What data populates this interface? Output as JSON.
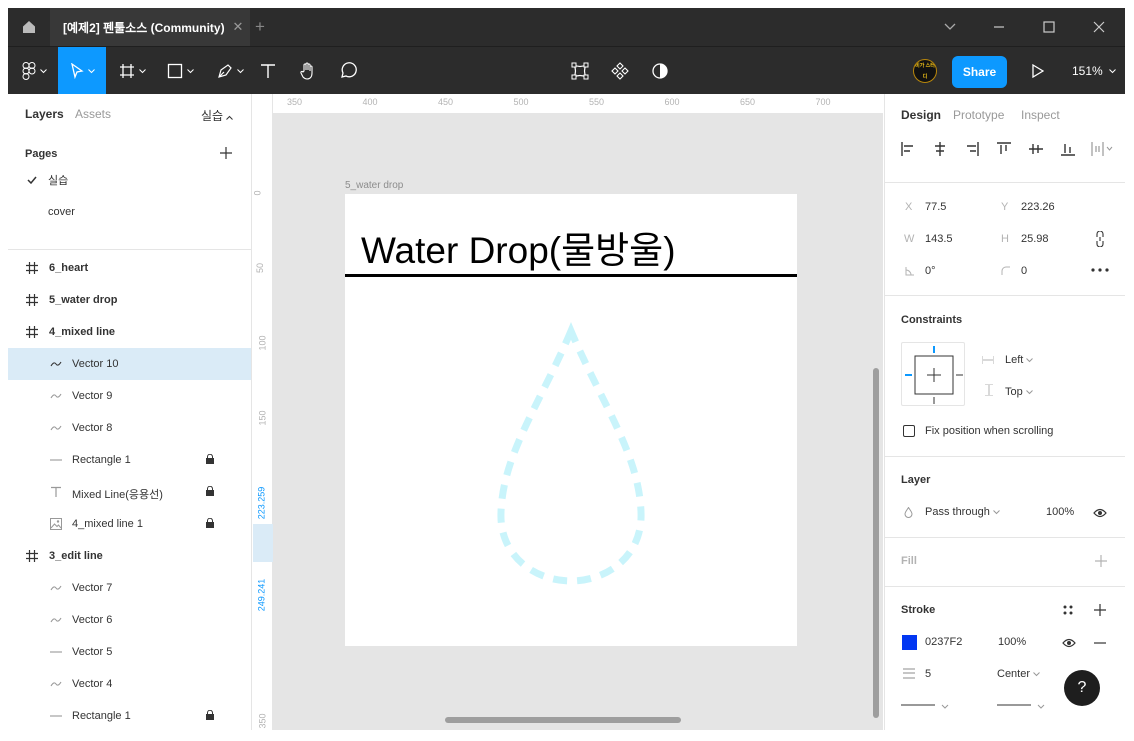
{
  "title_bar": {
    "tab_title": "[예제2] 펜툴소스 (Community)",
    "tab_close": "✕",
    "tab_add": "+"
  },
  "toolbar": {
    "share_label": "Share",
    "zoom": "151%",
    "avatar_text": "비가 스터디",
    "accent_color": "#0d99ff"
  },
  "left_panel": {
    "tabs": [
      "Layers",
      "Assets"
    ],
    "current_page_label": "실습",
    "pages_title": "Pages",
    "pages": [
      "실습",
      "cover"
    ],
    "layers": [
      {
        "label": "6_heart",
        "type": "frame",
        "indent": 0
      },
      {
        "label": "5_water drop",
        "type": "frame",
        "indent": 0
      },
      {
        "label": "4_mixed line",
        "type": "frame",
        "indent": 0
      },
      {
        "label": "Vector 10",
        "type": "vector",
        "indent": 1,
        "selected": true
      },
      {
        "label": "Vector 9",
        "type": "vector",
        "indent": 1
      },
      {
        "label": "Vector 8",
        "type": "vector",
        "indent": 1
      },
      {
        "label": "Rectangle 1",
        "type": "line",
        "indent": 1,
        "locked": true
      },
      {
        "label": "Mixed Line(응용선)",
        "type": "text",
        "indent": 1,
        "locked": true
      },
      {
        "label": "4_mixed line 1",
        "type": "image",
        "indent": 1,
        "locked": true
      },
      {
        "label": "3_edit line",
        "type": "frame",
        "indent": 0
      },
      {
        "label": "Vector 7",
        "type": "vector",
        "indent": 1
      },
      {
        "label": "Vector 6",
        "type": "vector",
        "indent": 1
      },
      {
        "label": "Vector 5",
        "type": "line",
        "indent": 1
      },
      {
        "label": "Vector 4",
        "type": "vector",
        "indent": 1
      },
      {
        "label": "Rectangle 1",
        "type": "line",
        "indent": 1,
        "locked": true
      }
    ]
  },
  "canvas": {
    "ruler_x": [
      "350",
      "400",
      "450",
      "500",
      "550",
      "600",
      "650",
      "700"
    ],
    "ruler_y": [
      "0",
      "50",
      "100",
      "150",
      "350"
    ],
    "ruler_y_sel_start": "223.259",
    "ruler_y_sel_end": "249.241",
    "frame_name": "5_water drop",
    "frame_title": "Water Drop(물방울)",
    "drop_color": "#c9f4fb"
  },
  "right_panel": {
    "tabs": [
      "Design",
      "Prototype",
      "Inspect"
    ],
    "x_label": "X",
    "x_value": "77.5",
    "y_label": "Y",
    "y_value": "223.26",
    "w_label": "W",
    "w_value": "143.5",
    "h_label": "H",
    "h_value": "25.98",
    "rotation": "0°",
    "radius": "0",
    "constraints_title": "Constraints",
    "constraint_h": "Left",
    "constraint_v": "Top",
    "fix_position_label": "Fix position when scrolling",
    "layer_title": "Layer",
    "blend_mode": "Pass through",
    "layer_opacity": "100%",
    "fill_title": "Fill",
    "stroke_title": "Stroke",
    "stroke_color_hex": "0237F2",
    "stroke_swatch": "#0237f2",
    "stroke_opacity": "100%",
    "stroke_weight": "5",
    "stroke_align": "Center",
    "help": "?"
  }
}
